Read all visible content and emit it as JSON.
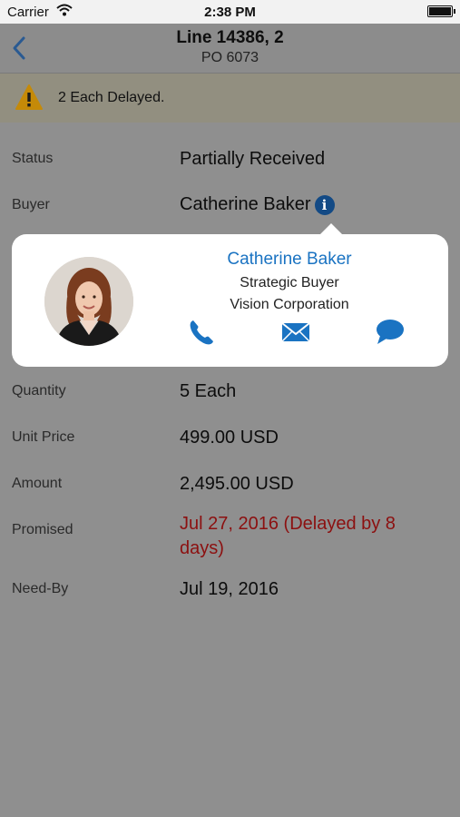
{
  "status_bar": {
    "carrier": "Carrier",
    "time": "2:38 PM"
  },
  "nav": {
    "title": "Line 14386, 2",
    "subtitle": "PO 6073",
    "back_icon": "chevron-left-icon"
  },
  "alert": {
    "icon": "warning-icon",
    "message": "2 Each Delayed."
  },
  "fields": {
    "status": {
      "label": "Status",
      "value": "Partially Received"
    },
    "buyer": {
      "label": "Buyer",
      "value": "Catherine Baker"
    },
    "quantity": {
      "label": "Quantity",
      "value": "5 Each"
    },
    "unit_price": {
      "label": "Unit Price",
      "value": "499.00 USD"
    },
    "amount": {
      "label": "Amount",
      "value": "2,495.00 USD"
    },
    "promised": {
      "label": "Promised",
      "value": "Jul 27, 2016 (Delayed by 8 days)"
    },
    "need_by": {
      "label": "Need-By",
      "value": "Jul 19, 2016"
    }
  },
  "contact_card": {
    "name": "Catherine Baker",
    "role": "Strategic Buyer",
    "company": "Vision Corporation",
    "actions": [
      "phone-icon",
      "mail-icon",
      "chat-icon"
    ]
  },
  "colors": {
    "accent": "#1a73c2",
    "delayed_text": "#8c1010",
    "info_badge": "#134a85",
    "warning": "#e5a000"
  }
}
